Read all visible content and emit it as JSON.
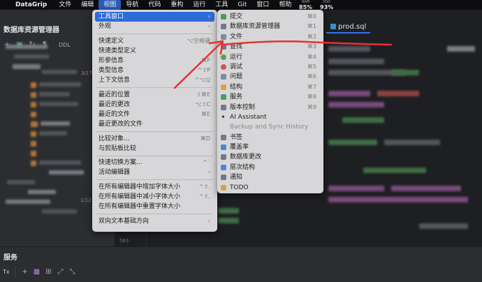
{
  "menubar": {
    "apple": "",
    "app_name": "DataGrip",
    "items": [
      "文件",
      "编辑",
      "视图",
      "导航",
      "代码",
      "重构",
      "运行",
      "工具",
      "Git",
      "窗口",
      "帮助"
    ],
    "status": [
      {
        "label": "RAM",
        "value": "85%"
      },
      {
        "label": "SSD",
        "value": "93%"
      }
    ]
  },
  "left_panel": {
    "title": "数据库资源管理器",
    "toolbar_ddl": "DDL",
    "blurred_labels": [
      "3/17",
      "1/12"
    ]
  },
  "editor": {
    "tab_title": "prod.sql",
    "tab_stub": "L",
    "line_number": "583"
  },
  "bottom_panel": {
    "title": "服务",
    "tx_label": "Tx"
  },
  "view_menu": {
    "items": [
      {
        "label": "工具窗口",
        "shortcut": "›",
        "selected": true
      },
      {
        "label": "外观",
        "shortcut": "›"
      },
      {
        "sep": true
      },
      {
        "label": "快速定义",
        "shortcut": "⌥空格键"
      },
      {
        "label": "快速类型定义",
        "shortcut": ""
      },
      {
        "label": "形参信息",
        "shortcut": "⌘P"
      },
      {
        "label": "类型信息",
        "shortcut": "^⇧P"
      },
      {
        "label": "上下文信息",
        "shortcut": "^⌥Q"
      },
      {
        "sep": true
      },
      {
        "label": "最近的位置",
        "shortcut": "⇧⌘E"
      },
      {
        "label": "最近的更改",
        "shortcut": "⌥⇧C"
      },
      {
        "label": "最近的文件",
        "shortcut": "⌘E"
      },
      {
        "label": "最近更改的文件",
        "shortcut": ""
      },
      {
        "sep": true
      },
      {
        "label": "比较对象...",
        "shortcut": "⌘D"
      },
      {
        "label": "与剪贴板比较",
        "shortcut": ""
      },
      {
        "sep": true
      },
      {
        "label": "快速切换方案...",
        "shortcut": "^`"
      },
      {
        "label": "活动编辑器",
        "shortcut": "›"
      },
      {
        "sep": true
      },
      {
        "label": "在所有编辑器中增加字体大小",
        "shortcut": "^⇧."
      },
      {
        "label": "在所有编辑器中减小字体大小",
        "shortcut": "^⇧,"
      },
      {
        "label": "在所有编辑器中重置字体大小",
        "shortcut": ""
      },
      {
        "sep": true
      },
      {
        "label": "双向文本基础方向",
        "shortcut": "›"
      }
    ]
  },
  "tool_menu": {
    "items": [
      {
        "label": "提交",
        "shortcut": "⌘0",
        "icon": "commit-icon",
        "color": "#4a9c5d"
      },
      {
        "label": "数据库资源管理器",
        "shortcut": "⌘1",
        "icon": "database-icon",
        "color": "#6c7a8c"
      },
      {
        "label": "文件",
        "shortcut": "⌘2",
        "icon": "folder-icon",
        "color": "#7d8a9e"
      },
      {
        "label": "查找",
        "shortcut": "⌘3",
        "icon": "find-icon",
        "color": "#6c7a8c"
      },
      {
        "label": "运行",
        "shortcut": "⌘4",
        "icon": "run-icon",
        "color": "#5aa05a"
      },
      {
        "label": "调试",
        "shortcut": "⌘5",
        "icon": "debug-icon",
        "color": "#d25252"
      },
      {
        "label": "问题",
        "shortcut": "⌘6",
        "icon": "problems-icon",
        "color": "#7d8a9e"
      },
      {
        "label": "结构",
        "shortcut": "⌘7",
        "icon": "structure-icon",
        "color": "#d9a343"
      },
      {
        "label": "服务",
        "shortcut": "⌘8",
        "icon": "services-icon",
        "color": "#4a9c5d"
      },
      {
        "label": "版本控制",
        "shortcut": "⌘9",
        "icon": "vcs-icon",
        "color": "#6c7a8c"
      },
      {
        "label": "AI Assistant",
        "shortcut": "",
        "icon": "ai-assistant-icon",
        "color": "#333333"
      },
      {
        "label": "Backup and Sync History",
        "shortcut": "",
        "icon": "",
        "color": "",
        "disabled": true
      },
      {
        "label": "书签",
        "shortcut": "",
        "icon": "bookmark-icon",
        "color": "#6c7a8c"
      },
      {
        "label": "覆盖率",
        "shortcut": "",
        "icon": "coverage-icon",
        "color": "#4a86d9"
      },
      {
        "label": "数据库更改",
        "shortcut": "",
        "icon": "database-changes-icon",
        "color": "#6c7a8c"
      },
      {
        "label": "层次结构",
        "shortcut": "",
        "icon": "hierarchy-icon",
        "color": "#4a86d9"
      },
      {
        "label": "通知",
        "shortcut": "",
        "icon": "notification-icon",
        "color": "#6c7a8c"
      },
      {
        "label": "TODO",
        "shortcut": "",
        "icon": "todo-icon",
        "color": "#d9a343"
      }
    ]
  },
  "colors": {
    "accent": "#2f6ad9",
    "annotation": "#e8312f"
  }
}
